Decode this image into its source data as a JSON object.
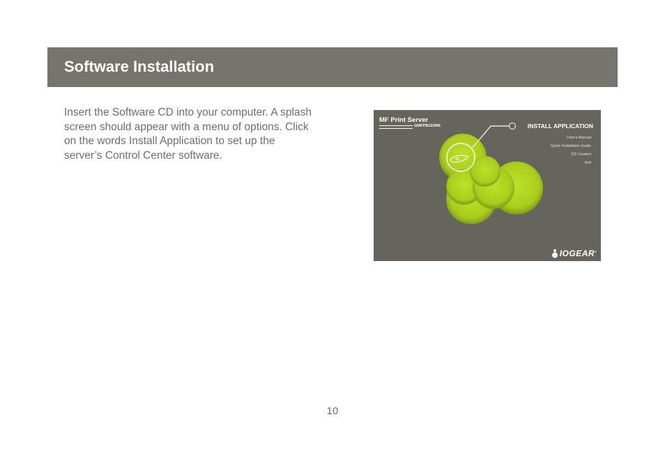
{
  "header": {
    "title": "Software Installation"
  },
  "instructions": "Insert the Software CD into your computer.  A splash screen should appear with a menu of options. Click on the words Install Application to set up the server’s Control Center software.",
  "splash_screen": {
    "product_name": "MF Print Server",
    "model_number": "GMFPSU22W6",
    "menu_primary": "INSTALL APPLICATION",
    "menu_items": [
      "User's Manual",
      "Quick Installation Guide",
      "CD Content",
      "Exit"
    ],
    "brand": "IOGEAR",
    "brand_mark": "®",
    "colors": {
      "background": "#66655d",
      "accent": "#b1d41e"
    }
  },
  "page_number": "10",
  "colors": {
    "header_bar": "#76756d",
    "body_text": "#6e6e6e"
  }
}
